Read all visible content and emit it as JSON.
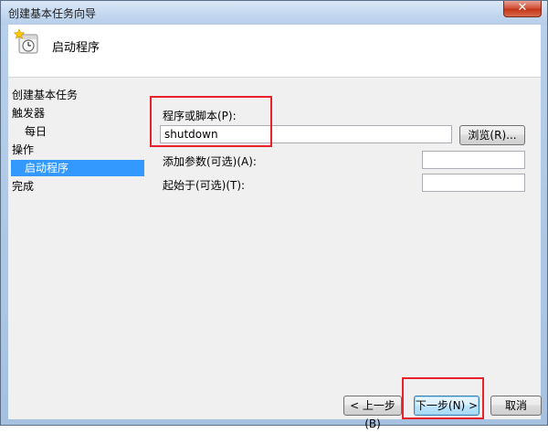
{
  "window": {
    "title": "创建基本任务向导",
    "close_glyph": "✕"
  },
  "header": {
    "title": "启动程序",
    "icon": "clock-icon"
  },
  "steps": [
    {
      "label": "创建基本任务"
    },
    {
      "label": "触发器"
    },
    {
      "label": "每日"
    },
    {
      "label": "操作"
    },
    {
      "label": "启动程序",
      "selected": true
    },
    {
      "label": "完成"
    }
  ],
  "form": {
    "program_label": "程序或脚本(P):",
    "program_value": "shutdown",
    "browse_label": "浏览(R)...",
    "args_label": "添加参数(可选)(A):",
    "args_value": "",
    "start_in_label": "起始于(可选)(T):",
    "start_in_value": ""
  },
  "footer": {
    "back_label": "< 上一步(B)",
    "next_label": "下一步(N) >",
    "cancel_label": "取消"
  },
  "colors": {
    "selection": "#3399ff",
    "highlight": "#e8212c",
    "window_frame": "#b9d1ea"
  }
}
